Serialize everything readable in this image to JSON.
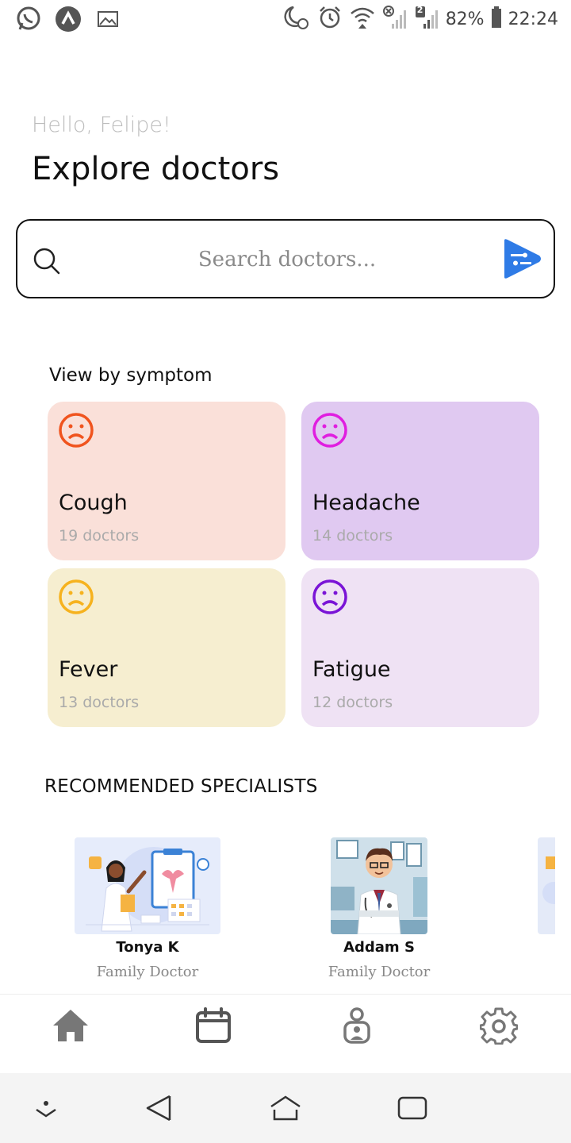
{
  "status_bar": {
    "battery": "82%",
    "time": "22:24",
    "sim_badge": "2",
    "icons": [
      "whatsapp-icon",
      "app-icon",
      "gallery-icon",
      "night-alarm-icon",
      "alarm-icon",
      "wifi-icon",
      "signal-icon",
      "signal-icon",
      "battery-icon"
    ]
  },
  "header": {
    "greeting": "Hello, Felipe!",
    "title": "Explore doctors"
  },
  "search": {
    "placeholder": "Search doctors...",
    "icon": "search-icon",
    "filter_icon": "filter-icon"
  },
  "symptoms": {
    "label": "View by symptom",
    "items": [
      {
        "name": "Cough",
        "count": "19 doctors",
        "bg": "#fae0d9",
        "face": "#f0541e"
      },
      {
        "name": "Headache",
        "count": "14 doctors",
        "bg": "#e0c9f1",
        "face": "#e01ee0"
      },
      {
        "name": "Fever",
        "count": "13 doctors",
        "bg": "#f6eed0",
        "face": "#f6b21e"
      },
      {
        "name": "Fatigue",
        "count": "12 doctors",
        "bg": "#efe2f4",
        "face": "#7a14d6"
      }
    ]
  },
  "specialists": {
    "label": "RECOMMENDED SPECIALISTS",
    "items": [
      {
        "name": "Tonya K",
        "role": "Family Doctor"
      },
      {
        "name": "Addam S",
        "role": "Family Doctor"
      }
    ]
  },
  "bottom_nav": {
    "icons": [
      "home-icon",
      "calendar-icon",
      "profile-icon",
      "settings-icon"
    ],
    "color": "#777777"
  },
  "system_nav": {
    "icons": [
      "hide-keyboard-icon",
      "back-icon",
      "home-icon",
      "recents-icon"
    ]
  }
}
